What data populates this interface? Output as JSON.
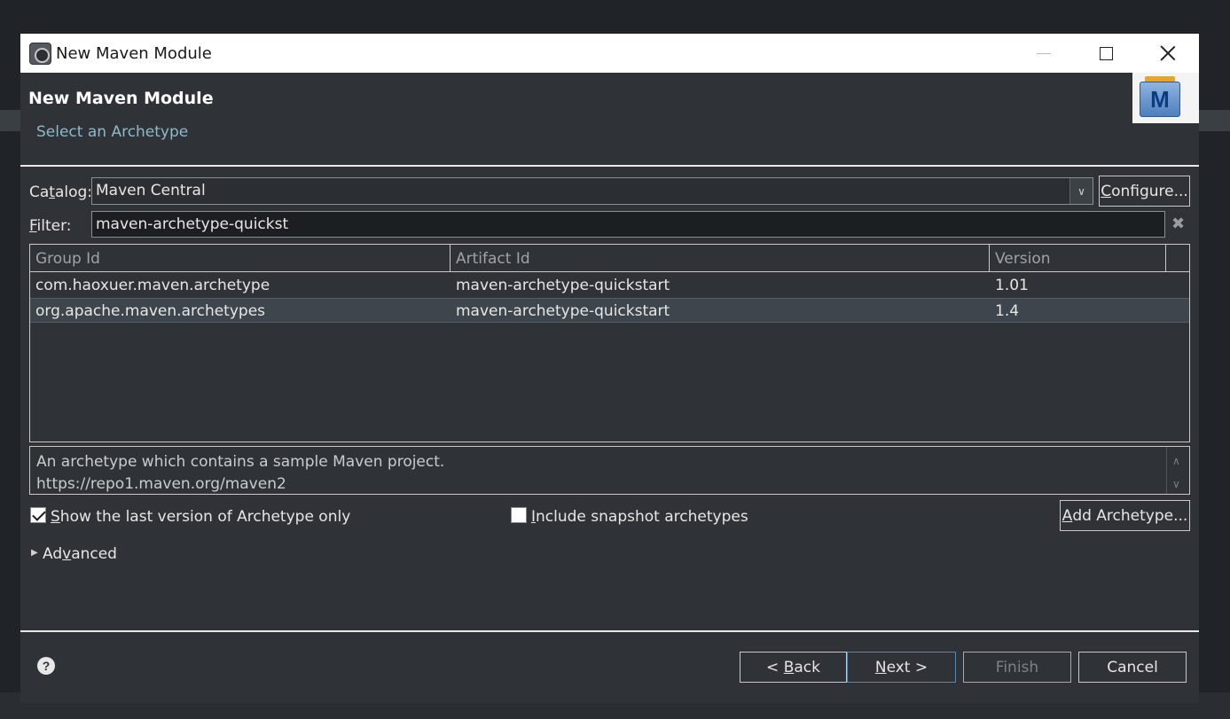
{
  "window": {
    "title": "New Maven Module"
  },
  "header": {
    "title": "New Maven Module",
    "subtitle": "Select an Archetype",
    "logo_letter": "M"
  },
  "catalog": {
    "label_pre": "Ca",
    "label_mnemonic": "t",
    "label_post": "alog:",
    "value": "Maven Central",
    "configure_pre": "",
    "configure_mnemonic": "C",
    "configure_post": "onfigure..."
  },
  "filter": {
    "label_mnemonic": "F",
    "label_post": "ilter:",
    "value": "maven-archetype-quickst"
  },
  "table": {
    "columns": [
      "Group Id",
      "Artifact Id",
      "Version"
    ],
    "rows": [
      {
        "group_id": "com.haoxuer.maven.archetype",
        "artifact_id": "maven-archetype-quickstart",
        "version": "1.01",
        "selected": false
      },
      {
        "group_id": "org.apache.maven.archetypes",
        "artifact_id": "maven-archetype-quickstart",
        "version": "1.4",
        "selected": true
      }
    ]
  },
  "description": {
    "line1": "An archetype which contains a sample Maven project.",
    "line2": "https://repo1.maven.org/maven2"
  },
  "options": {
    "show_last_version": {
      "mnemonic": "S",
      "rest": "how the last version of Archetype only",
      "checked": true
    },
    "include_snapshot": {
      "mnemonic": "I",
      "rest": "nclude snapshot archetypes",
      "checked": false
    },
    "add_archetype": {
      "mnemonic": "A",
      "rest": "dd Archetype..."
    }
  },
  "advanced": {
    "pre": "Ad",
    "mnemonic": "v",
    "post": "anced"
  },
  "buttons": {
    "back_pre": "< ",
    "back_mnemonic": "B",
    "back_post": "ack",
    "next_mnemonic": "N",
    "next_post": "ext >",
    "finish": "Finish",
    "cancel": "Cancel"
  },
  "colors": {
    "dialog_bg": "#2f3337",
    "subtitle": "#8fb8c8",
    "focus_border": "#3b8edb"
  }
}
